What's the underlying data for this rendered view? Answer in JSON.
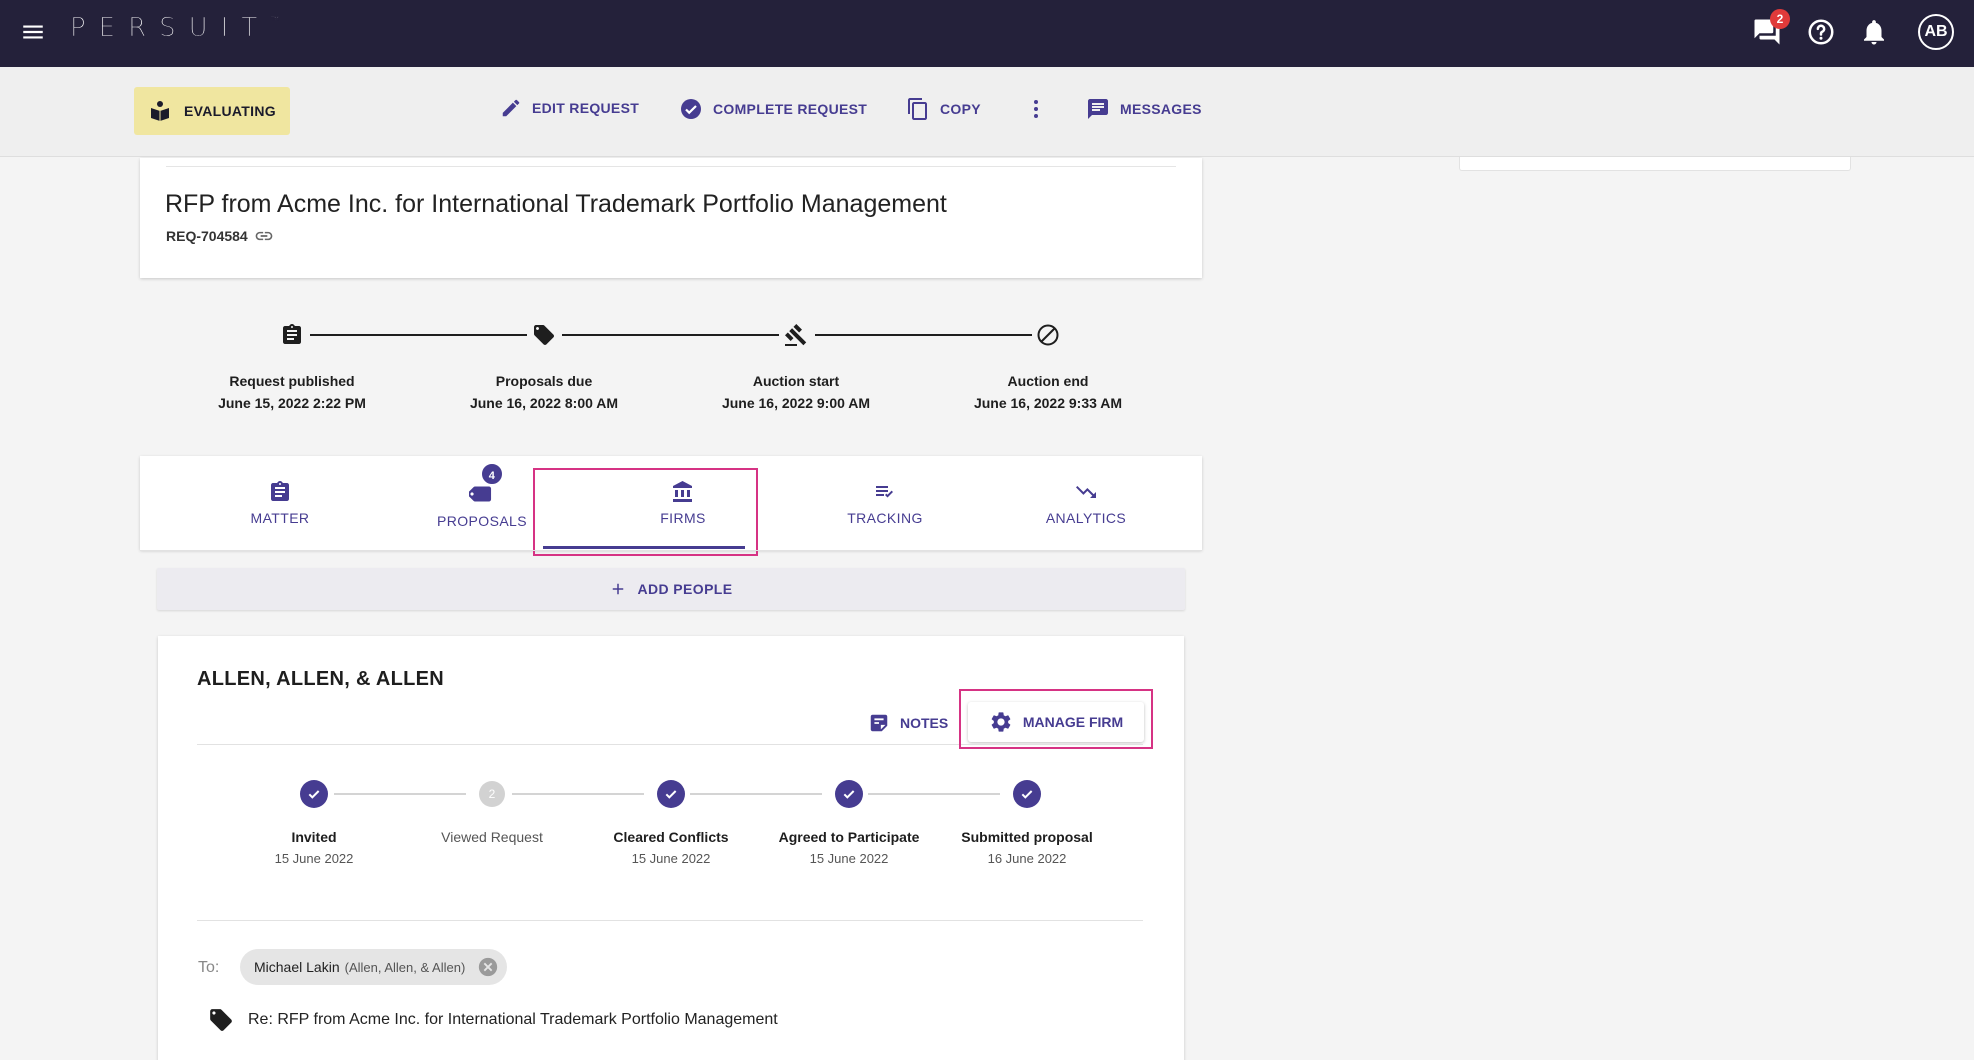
{
  "topbar": {
    "brand": "PERSUIT",
    "brand_mark": "™",
    "chat_badge": "2",
    "avatar_initials": "AB"
  },
  "actionbar": {
    "status": "EVALUATING",
    "edit_request": "EDIT REQUEST",
    "complete_request": "COMPLETE REQUEST",
    "copy": "COPY",
    "messages": "MESSAGES"
  },
  "request": {
    "title": "RFP from Acme Inc. for International Trademark Portfolio Management",
    "id": "REQ-704584"
  },
  "timeline": [
    {
      "label": "Request published",
      "date": "June 15, 2022 2:22 PM",
      "icon": "clipboard-icon"
    },
    {
      "label": "Proposals due",
      "date": "June 16, 2022 8:00 AM",
      "icon": "tag-icon"
    },
    {
      "label": "Auction start",
      "date": "June 16, 2022 9:00 AM",
      "icon": "gavel-icon"
    },
    {
      "label": "Auction end",
      "date": "June 16, 2022 9:33 AM",
      "icon": "block-icon"
    }
  ],
  "tabs": {
    "matter": "MATTER",
    "proposals": "PROPOSALS",
    "proposals_badge": "4",
    "firms": "FIRMS",
    "tracking": "TRACKING",
    "analytics": "ANALYTICS",
    "active": "FIRMS"
  },
  "add_people": "ADD PEOPLE",
  "firm": {
    "name": "ALLEN, ALLEN, & ALLEN",
    "notes": "NOTES",
    "manage": "MANAGE FIRM",
    "steps": [
      {
        "title": "Invited",
        "date": "15 June 2022",
        "done": true
      },
      {
        "title": "Viewed Request",
        "date": "",
        "done": false,
        "number": "2"
      },
      {
        "title": "Cleared Conflicts",
        "date": "15 June 2022",
        "done": true
      },
      {
        "title": "Agreed to Participate",
        "date": "15 June 2022",
        "done": true
      },
      {
        "title": "Submitted proposal",
        "date": "16 June 2022",
        "done": true
      }
    ],
    "to_label": "To:",
    "recipient": {
      "name": "Michael Lakin",
      "org": "(Allen, Allen, & Allen)"
    },
    "subject": "Re: RFP from Acme Inc. for International Trademark Portfolio Management"
  },
  "colors": {
    "topbar": "#24213a",
    "accent": "#463c91",
    "status_bg": "#f0e6a0",
    "highlight": "#d63384",
    "badge_red": "#e03a3a"
  }
}
